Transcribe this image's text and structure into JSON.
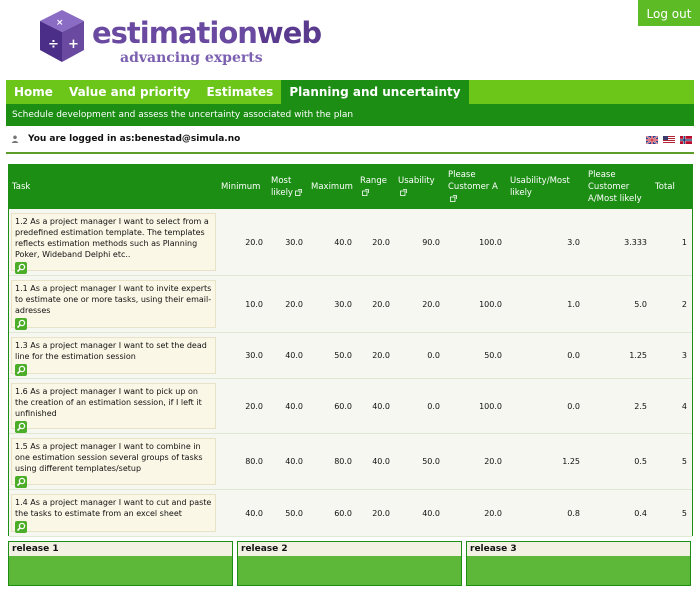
{
  "header": {
    "brand_part1": "estimation",
    "brand_part2": "web",
    "tagline": "advancing experts",
    "logout_label": "Log out"
  },
  "nav": {
    "tabs": [
      {
        "label": "Home",
        "active": false
      },
      {
        "label": "Value and priority",
        "active": false
      },
      {
        "label": "Estimates",
        "active": false
      },
      {
        "label": "Planning and uncertainty",
        "active": true
      }
    ],
    "subtitle": "Schedule development and assess the uncertainty associated with the plan"
  },
  "user": {
    "login_text": "You are logged in as:benestad@simula.no",
    "flags": [
      "uk-flag",
      "us-flag",
      "norway-flag"
    ]
  },
  "table": {
    "headers": [
      "Task",
      "Minimum",
      "Most likely",
      "Maximum",
      "Range",
      "Usability",
      "Please Customer A",
      "Usability/Most likely",
      "Please Customer A/Most likely",
      "Total"
    ],
    "rows": [
      {
        "task": "1.2 As a project manager I want to select from a predefined estimation template. The templates reflects estimation methods such as Planning Poker, Wideband Delphi etc..",
        "minimum": "20.0",
        "most_likely": "30.0",
        "maximum": "40.0",
        "range": "20.0",
        "usability": "90.0",
        "customer_a": "100.0",
        "usability_most_likely": "3.0",
        "customer_a_most_likely": "3.333",
        "total": "1"
      },
      {
        "task": "1.1 As a project manager I want to invite experts to estimate one or more tasks, using their email-adresses",
        "minimum": "10.0",
        "most_likely": "20.0",
        "maximum": "30.0",
        "range": "20.0",
        "usability": "20.0",
        "customer_a": "100.0",
        "usability_most_likely": "1.0",
        "customer_a_most_likely": "5.0",
        "total": "2"
      },
      {
        "task": "1.3 As a project manager I want to set the dead line for the estimation session",
        "minimum": "30.0",
        "most_likely": "40.0",
        "maximum": "50.0",
        "range": "20.0",
        "usability": "0.0",
        "customer_a": "50.0",
        "usability_most_likely": "0.0",
        "customer_a_most_likely": "1.25",
        "total": "3"
      },
      {
        "task": "1.6 As a project manager I want to pick up on the creation of an estimation session, if I left it unfinished",
        "minimum": "20.0",
        "most_likely": "40.0",
        "maximum": "60.0",
        "range": "40.0",
        "usability": "0.0",
        "customer_a": "100.0",
        "usability_most_likely": "0.0",
        "customer_a_most_likely": "2.5",
        "total": "4"
      },
      {
        "task": "1.5 As a project manager I want to combine in one estimation session several groups of tasks using different templates/setup",
        "minimum": "80.0",
        "most_likely": "40.0",
        "maximum": "80.0",
        "range": "40.0",
        "usability": "50.0",
        "customer_a": "20.0",
        "usability_most_likely": "1.25",
        "customer_a_most_likely": "0.5",
        "total": "5"
      },
      {
        "task": "1.4 As a project manager I want to cut and paste the tasks to estimate from an excel sheet",
        "minimum": "40.0",
        "most_likely": "50.0",
        "maximum": "60.0",
        "range": "20.0",
        "usability": "40.0",
        "customer_a": "20.0",
        "usability_most_likely": "0.8",
        "customer_a_most_likely": "0.4",
        "total": "5"
      }
    ]
  },
  "releases": [
    "release 1",
    "release 2",
    "release 3"
  ],
  "colors": {
    "nav_green": "#6cc61a",
    "dark_green": "#1c8e14",
    "logout_green": "#5dbb26",
    "release_green": "#5db83a",
    "brand_purple": "#6a4aa0"
  }
}
